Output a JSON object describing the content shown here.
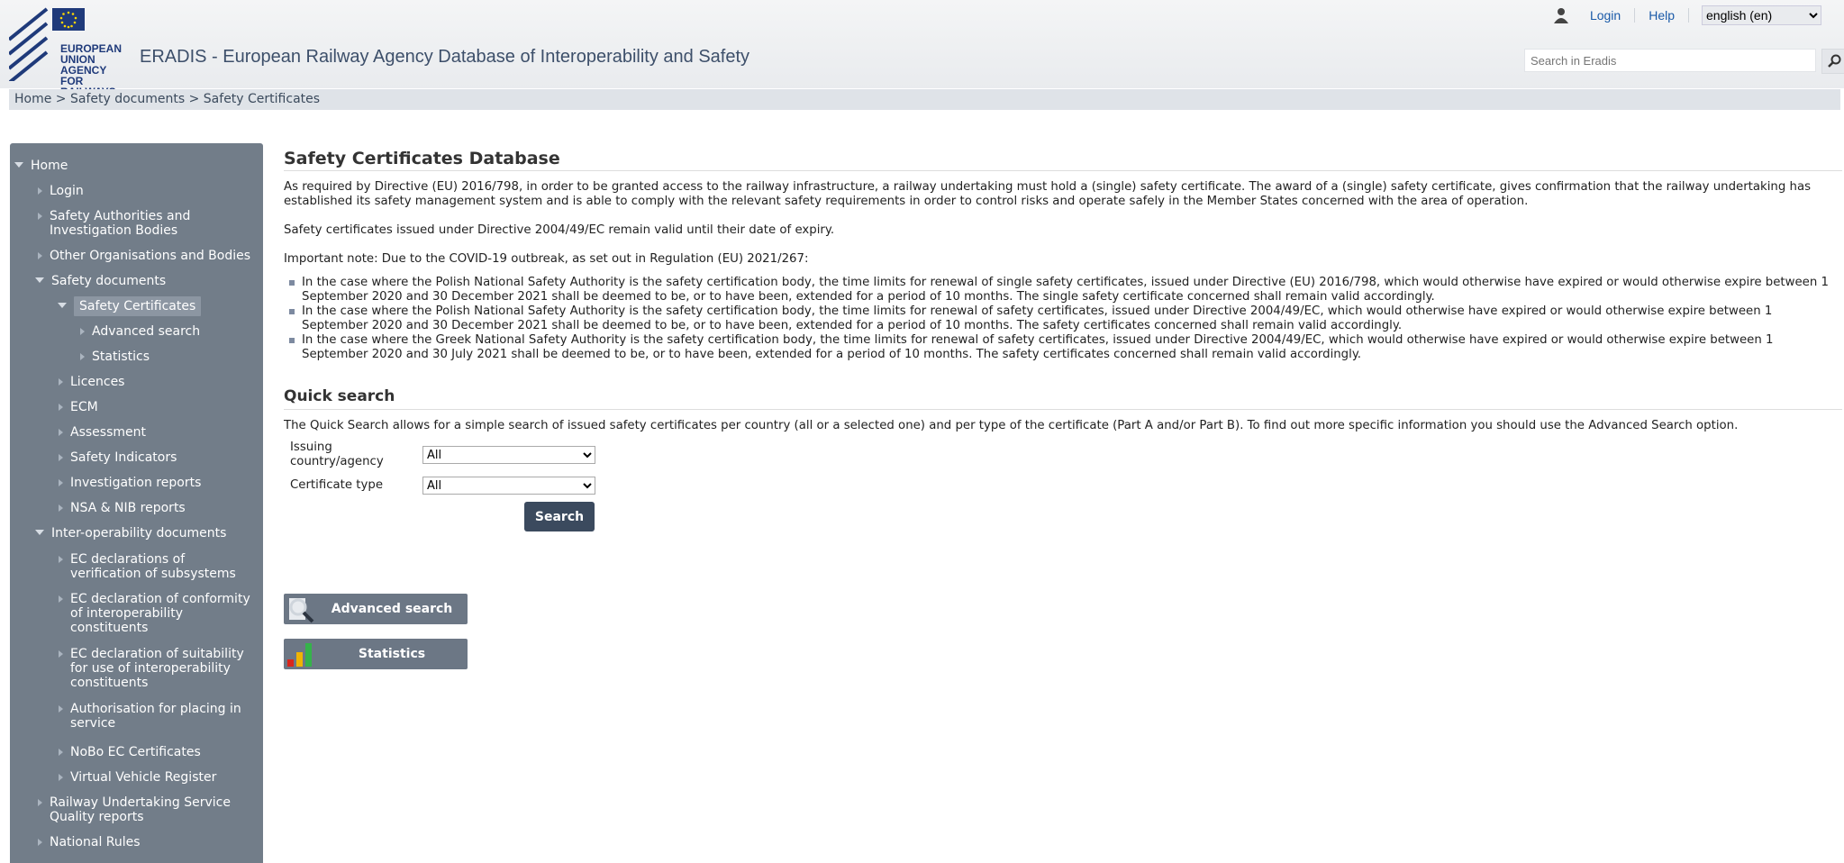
{
  "header": {
    "logo_lines": [
      "EUROPEAN",
      "UNION",
      "AGENCY",
      "FOR RAILWAYS"
    ],
    "site_title": "ERADIS - European Railway Agency Database of Interoperability and Safety",
    "login_label": "Login",
    "help_label": "Help",
    "language_selected": "english (en)",
    "search_placeholder": "Search in Eradis"
  },
  "breadcrumb": {
    "items": [
      "Home",
      "Safety documents",
      "Safety Certificates"
    ],
    "separator": ">"
  },
  "sidebar": {
    "items": [
      {
        "label": "Home",
        "expanded": true
      },
      {
        "label": "Login"
      },
      {
        "label": "Safety Authorities and Investigation Bodies"
      },
      {
        "label": "Other Organisations and Bodies"
      },
      {
        "label": "Safety documents",
        "expanded": true
      },
      {
        "label": "Safety Certificates",
        "expanded": true,
        "selected": true
      },
      {
        "label": "Advanced search"
      },
      {
        "label": "Statistics"
      },
      {
        "label": "Licences"
      },
      {
        "label": "ECM"
      },
      {
        "label": "Assessment"
      },
      {
        "label": "Safety Indicators"
      },
      {
        "label": "Investigation reports"
      },
      {
        "label": "NSA & NIB reports"
      },
      {
        "label": "Inter-operability documents",
        "expanded": true
      },
      {
        "label": "EC declarations of verification of subsystems"
      },
      {
        "label": "EC declaration of conformity of interoperability constituents"
      },
      {
        "label": "EC declaration of suitability for use of interoperability constituents"
      },
      {
        "label": "Authorisation for placing in service"
      },
      {
        "label": "NoBo EC Certificates"
      },
      {
        "label": "Virtual Vehicle Register"
      },
      {
        "label": "Railway Undertaking Service Quality reports"
      },
      {
        "label": "National Rules"
      }
    ]
  },
  "main": {
    "title": "Safety Certificates Database",
    "intro": "As required by Directive (EU) 2016/798, in order to be granted access to the railway infrastructure, a railway undertaking must hold a (single) safety certificate. The award of a (single) safety certificate, gives confirmation that the railway undertaking has established its safety management system and is able to comply with the relevant safety requirements in order to control risks and operate safely in the Member States concerned with the area of operation.",
    "validity_note": "Safety certificates issued under Directive 2004/49/EC remain valid until their date of expiry.",
    "important_note": "Important note: Due to the COVID-19 outbreak, as set out in Regulation (EU) 2021/267:",
    "bullets": [
      "In the case where the Polish National Safety Authority is the safety certification body, the time limits for renewal of single safety certificates, issued under Directive (EU) 2016/798, which would otherwise have expired or would otherwise expire between 1 September 2020 and 30 December 2021 shall be deemed to be, or to have been, extended for a period of 10 months. The single safety certificate concerned shall remain valid accordingly.",
      "In the case where the Polish National Safety Authority is the safety certification body, the time limits for renewal of safety certificates, issued under Directive 2004/49/EC, which would otherwise have expired or would otherwise expire between 1 September 2020 and 30 December 2021 shall be deemed to be, or to have been, extended for a period of 10 months. The safety certificates concerned shall remain valid accordingly.",
      "In the case where the Greek National Safety Authority is the safety certification body, the time limits for renewal of safety certificates, issued under Directive 2004/49/EC, which would otherwise have expired or would otherwise expire between 1 September 2020 and 30 July 2021 shall be deemed to be, or to have been, extended for a period of 10 months. The safety certificates concerned shall remain valid accordingly."
    ],
    "quick_search": {
      "title": "Quick search",
      "description": "The Quick Search allows for a simple search of issued safety certificates per country (all or a selected one) and per type of the certificate (Part A and/or Part B). To find out more specific information you should use the Advanced Search option.",
      "country_label": "Issuing country/agency",
      "country_value": "All",
      "type_label": "Certificate type",
      "type_value": "All",
      "search_button": "Search"
    },
    "advanced_search_button": "Advanced search",
    "statistics_button": "Statistics"
  },
  "colors": {
    "sidebar_bg": "#727d89",
    "link": "#1a5aa8",
    "button_dark": "#3b4a5e",
    "eu_blue": "#1f3a7a"
  }
}
